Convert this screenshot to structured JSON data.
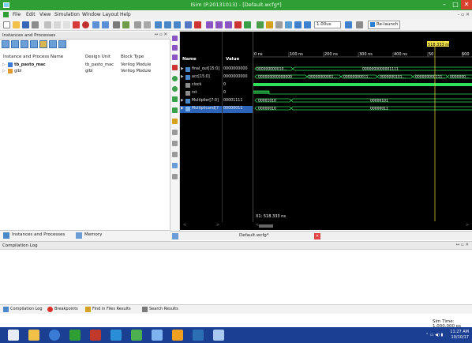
{
  "window": {
    "title": "ISim (P.20131013) - [Default.wcfg*]",
    "controls": [
      "–",
      "□",
      "✕"
    ]
  },
  "menu": [
    "File",
    "Edit",
    "View",
    "Simulation",
    "Window",
    "Layout",
    "Help"
  ],
  "toolbar": {
    "run_time": "1.00us",
    "relaunch_label": "Re-launch"
  },
  "instances_panel": {
    "title": "Instances and Processes",
    "columns": [
      "Instance and Process Name",
      "Design Unit",
      "Block Type"
    ],
    "rows": [
      {
        "name": "tb_pasto_mac",
        "unit": "tb_pasto_mac",
        "type": "Verilog Module"
      },
      {
        "name": "glbl",
        "unit": "glbl",
        "type": "Verilog Module"
      }
    ],
    "tabs": [
      "Instances and Processes",
      "Memory"
    ]
  },
  "wave": {
    "headers": {
      "name": "Name",
      "value": "Value"
    },
    "cursor_marker": "518.333 ns",
    "time_ticks": [
      "0 ns",
      "100 ns",
      "200 ns",
      "300 ns",
      "400 ns",
      "50",
      "600"
    ],
    "signals": [
      {
        "name": "final_out[15:0]",
        "value": "0000000000"
      },
      {
        "name": "acc[15:0]",
        "value": "0000000000"
      },
      {
        "name": "clock",
        "value": "0"
      },
      {
        "name": "rst",
        "value": "0"
      },
      {
        "name": "Multiplier[7:0]",
        "value": "00001111"
      },
      {
        "name": "Multiplicand[7",
        "value": "00000011"
      }
    ],
    "bus_labels": {
      "final_out_a": "000000000010...",
      "final_out_b": "0000000000001111",
      "acc_a": "000000000000000",
      "acc_b": "00000000001...",
      "acc_c": "00000000011...",
      "acc_d": "0000000101...",
      "acc_e": "000000000111...",
      "acc_f": "0000000...",
      "mult_a": "00001010",
      "mult_b": "00000101",
      "mcand_a": "00000010",
      "mcand_b": "00000011"
    },
    "cursor_readout": "X1: 518.333 ns"
  },
  "editor": {
    "tab": "Default.wcfg*"
  },
  "console": {
    "title": "Compilation Log",
    "tabs": [
      "Compilation Log",
      "Breakpoints",
      "Find in Files Results",
      "Search Results"
    ],
    "sim_time": "Sim Time: 1,000,000 ps"
  },
  "taskbar": {
    "time": "11:27 AM",
    "date": "10/10/17"
  },
  "colors": {
    "title_green": "#2e9e35",
    "wave_green": "#2ee05a",
    "taskbar_blue": "#1b3f93",
    "selection_blue": "#2b64b8"
  }
}
